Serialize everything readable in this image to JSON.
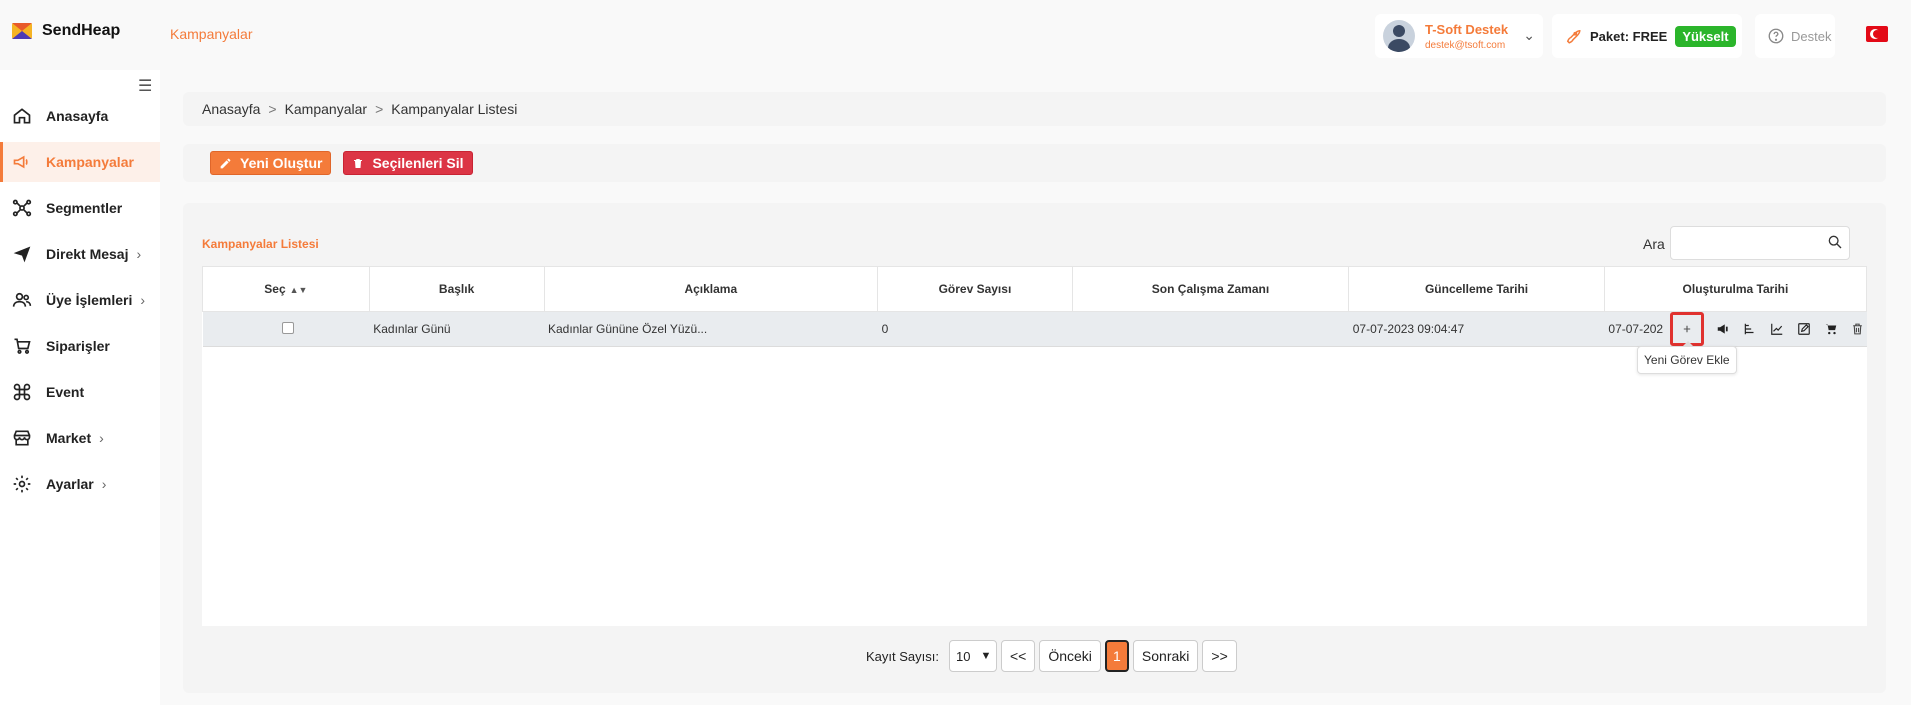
{
  "app": {
    "name": "SendHeap",
    "page_title": "Kampanyalar"
  },
  "header": {
    "user": {
      "name": "T-Soft Destek",
      "email": "destek@tsoft.com"
    },
    "package": {
      "label": "Paket: FREE",
      "upgrade": "Yükselt"
    },
    "support": "Destek",
    "colors": {
      "accent": "#f47b3a",
      "success": "#2bb52b",
      "danger": "#dc3545"
    }
  },
  "sidebar": {
    "items": [
      {
        "label": "Anasayfa",
        "icon": "home-icon"
      },
      {
        "label": "Kampanyalar",
        "icon": "megaphone-icon",
        "active": true
      },
      {
        "label": "Segmentler",
        "icon": "network-icon"
      },
      {
        "label": "Direkt Mesaj",
        "icon": "send-icon",
        "chevron": "›"
      },
      {
        "label": "Üye İşlemleri",
        "icon": "users-icon",
        "chevron": "›"
      },
      {
        "label": "Siparişler",
        "icon": "cart-icon"
      },
      {
        "label": "Event",
        "icon": "command-icon"
      },
      {
        "label": "Market",
        "icon": "store-icon",
        "chevron": "›"
      },
      {
        "label": "Ayarlar",
        "icon": "gear-icon",
        "chevron": "›"
      }
    ]
  },
  "breadcrumb": [
    "Anasayfa",
    "Kampanyalar",
    "Kampanyalar Listesi"
  ],
  "actions": {
    "create": "Yeni Oluştur",
    "delete_selected": "Seçilenleri Sil"
  },
  "list": {
    "title": "Kampanyalar Listesi",
    "search_label": "Ara",
    "columns": [
      "Seç",
      "Başlık",
      "Açıklama",
      "Görev Sayısı",
      "Son Çalışma Zamanı",
      "Güncelleme Tarihi",
      "Oluşturulma Tarihi"
    ],
    "rows": [
      {
        "title": "Kadınlar Günü",
        "description": "Kadınlar Gününe Özel Yüzü...",
        "task_count": "0",
        "last_run": "",
        "updated": "07-07-2023 09:04:47",
        "created": "07-07-202"
      }
    ],
    "tooltip": "Yeni Görev Ekle"
  },
  "pagination": {
    "label": "Kayıt Sayısı:",
    "page_size": "10",
    "first": "<<",
    "prev": "Önceki",
    "current": "1",
    "next": "Sonraki",
    "last": ">>"
  }
}
